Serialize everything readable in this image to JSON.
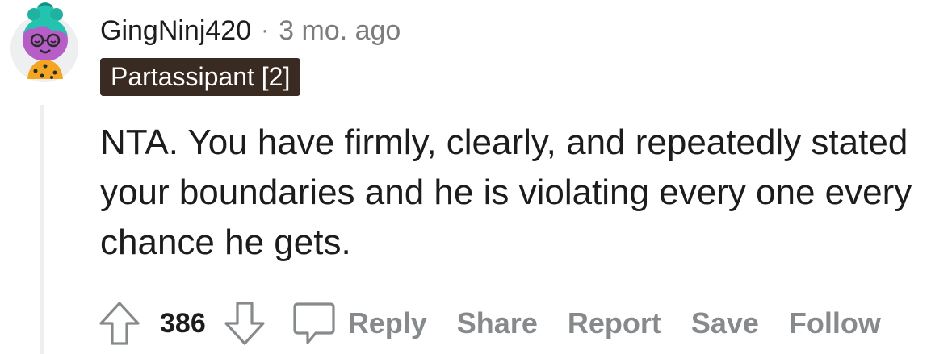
{
  "comment": {
    "author": "GingNinj420",
    "separator": "·",
    "time": "3 mo. ago",
    "flair": "Partassipant [2]",
    "body": "NTA. You have firmly, clearly, and repeatedly stated your boundaries and he is violating every one every chance he gets."
  },
  "actions": {
    "score": "386",
    "reply_label": "Reply",
    "share_label": "Share",
    "report_label": "Report",
    "save_label": "Save",
    "follow_label": "Follow"
  },
  "icons": {
    "upvote": "upvote-arrow-icon",
    "downvote": "downvote-arrow-icon",
    "comment": "comment-bubble-icon"
  },
  "colors": {
    "flair_background": "#3a2b22",
    "flair_text": "#ffffff",
    "muted_text": "#7c7c7c",
    "action_text": "#878a8c",
    "thread_line": "#edeff1",
    "avatar_hair": "#22c4b0",
    "avatar_face": "#b65dc7",
    "avatar_shirt": "#f4a623"
  }
}
